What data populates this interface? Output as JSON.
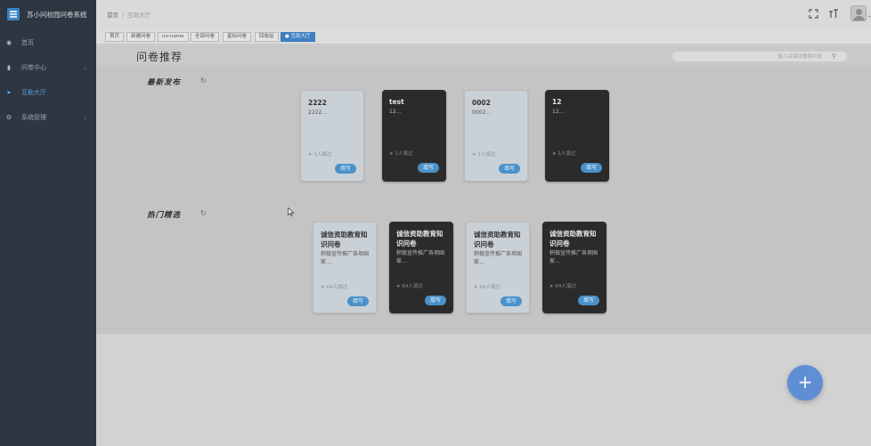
{
  "app": {
    "title": "苏小问校园问卷系统"
  },
  "sidebar": {
    "items": [
      {
        "label": "首页",
        "icon": "dashboard-icon",
        "active": false,
        "has_caret": false
      },
      {
        "label": "问卷中心",
        "icon": "document-icon",
        "active": false,
        "has_caret": true
      },
      {
        "label": "互助大厅",
        "icon": "send-icon",
        "active": true,
        "has_caret": false
      },
      {
        "label": "系统管理",
        "icon": "gear-icon",
        "active": false,
        "has_caret": true
      }
    ]
  },
  "header": {
    "breadcrumb": [
      "首页",
      "互助大厅"
    ],
    "icons": [
      "fullscreen-icon",
      "font-size-icon",
      "avatar"
    ]
  },
  "tags": [
    {
      "label": "首页",
      "active": false
    },
    {
      "label": "新建问卷",
      "active": false
    },
    {
      "label": "no-name",
      "active": false
    },
    {
      "label": "全部问卷",
      "active": false
    },
    {
      "label": "星标问卷",
      "active": false
    },
    {
      "label": "回收站",
      "active": false
    },
    {
      "label": "● 互助大厅",
      "active": true
    }
  ],
  "page": {
    "title": "问卷推荐",
    "search_placeholder": "输入关键词搜索问卷"
  },
  "sections": {
    "latest": {
      "title": "最新发布",
      "cards": [
        {
          "title": "2222",
          "desc": "2222...",
          "count": "1人填过",
          "button": "填写",
          "theme": "light"
        },
        {
          "title": "test",
          "desc": "12...",
          "count": "1人填过",
          "button": "填写",
          "theme": "dark"
        },
        {
          "title": "0002",
          "desc": "0002...",
          "count": "1人填过",
          "button": "填写",
          "theme": "light"
        },
        {
          "title": "12",
          "desc": "12...",
          "count": "1人填过",
          "button": "填写",
          "theme": "dark"
        }
      ]
    },
    "popular": {
      "title": "热门精选",
      "cards": [
        {
          "title": "诚信资助教育知识问卷",
          "desc": "积极宣传推广各项国家...",
          "count": "64人填过",
          "button": "填写",
          "theme": "light"
        },
        {
          "title": "诚信资助教育知识问卷",
          "desc": "积极宣传推广各项国家...",
          "count": "64人填过",
          "button": "填写",
          "theme": "dark"
        },
        {
          "title": "诚信资助教育知识问卷",
          "desc": "积极宣传推广各项国家...",
          "count": "64人填过",
          "button": "填写",
          "theme": "light"
        },
        {
          "title": "诚信资助教育知识问卷",
          "desc": "积极宣传推广各项国家...",
          "count": "64人填过",
          "button": "填写",
          "theme": "dark"
        }
      ]
    }
  },
  "fab": {
    "label": "+"
  }
}
